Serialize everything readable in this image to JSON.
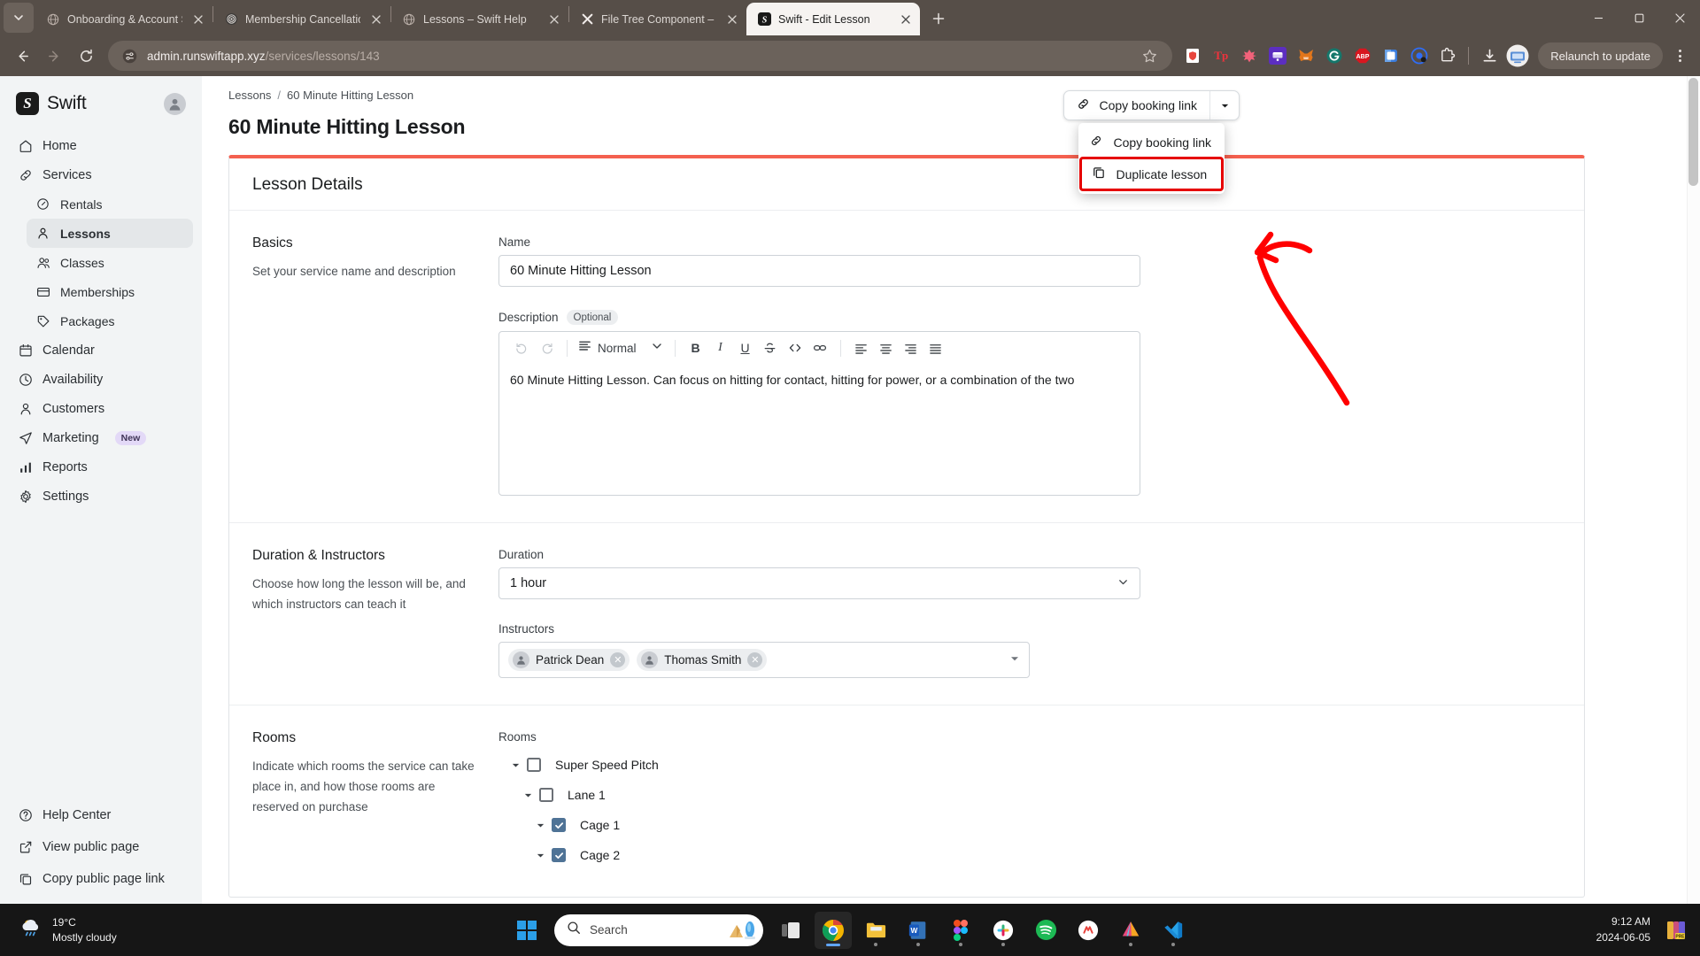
{
  "browser": {
    "tabs": [
      {
        "title": "Onboarding & Account Setup -",
        "favicon": "globe-icon",
        "active": false
      },
      {
        "title": "Membership Cancellation Instru",
        "favicon": "fingerprint-icon",
        "active": false
      },
      {
        "title": "Lessons – Swift Help",
        "favicon": "globe-icon",
        "active": false
      },
      {
        "title": "File Tree Component – Nextra",
        "favicon": "nextra-icon",
        "active": false
      },
      {
        "title": "Swift - Edit Lesson",
        "favicon": "swift-icon",
        "active": true
      }
    ],
    "new_tab_label": "+",
    "url_host": "admin.runswiftapp.xyz",
    "url_path": "/services/lessons/143",
    "relaunch_label": "Relaunch to update",
    "extensions": [
      {
        "name": "shield-extension-icon",
        "glyph": "",
        "color": "#e8453c"
      },
      {
        "name": "tp-extension-icon",
        "glyph": "Tp",
        "color": "#f0323c"
      },
      {
        "name": "puzzle-pink-extension-icon",
        "glyph": "",
        "color": "#f2627a"
      },
      {
        "name": "rabby-wallet-icon",
        "glyph": "",
        "color": "#5c2ec0"
      },
      {
        "name": "metamask-icon",
        "glyph": "",
        "color": "#e2761b"
      },
      {
        "name": "grammarly-icon",
        "glyph": "G",
        "color": "#15776b"
      },
      {
        "name": "adblock-plus-icon",
        "glyph": "ABP",
        "color": "#d8161f"
      },
      {
        "name": "bitwarden-icon",
        "glyph": "",
        "color": "#3b7ddd"
      },
      {
        "name": "loom-icon",
        "glyph": "",
        "color": "#2f6df6"
      },
      {
        "name": "extensions-puzzle-icon",
        "glyph": "",
        "color": "#ffffff"
      }
    ],
    "download_icon": "download-icon",
    "profile_icon": "profile-avatar-icon",
    "window_controls": [
      "minimize",
      "maximize",
      "close"
    ]
  },
  "sidebar": {
    "brand": {
      "logo_letter": "S",
      "name": "Swift"
    },
    "items": [
      {
        "label": "Home",
        "icon": "home-icon",
        "level": 0,
        "active": false
      },
      {
        "label": "Services",
        "icon": "link-icon",
        "level": 0,
        "active": false
      },
      {
        "label": "Rentals",
        "icon": "gauge-icon",
        "level": 1,
        "active": false
      },
      {
        "label": "Lessons",
        "icon": "person-icon",
        "level": 1,
        "active": true
      },
      {
        "label": "Classes",
        "icon": "people-icon",
        "level": 1,
        "active": false
      },
      {
        "label": "Memberships",
        "icon": "card-icon",
        "level": 1,
        "active": false
      },
      {
        "label": "Packages",
        "icon": "tags-icon",
        "level": 1,
        "active": false
      },
      {
        "label": "Calendar",
        "icon": "calendar-icon",
        "level": 0,
        "active": false
      },
      {
        "label": "Availability",
        "icon": "clock-icon",
        "level": 0,
        "active": false
      },
      {
        "label": "Customers",
        "icon": "person-icon",
        "level": 0,
        "active": false
      },
      {
        "label": "Marketing",
        "icon": "send-icon",
        "level": 0,
        "active": false,
        "badge": "New"
      },
      {
        "label": "Reports",
        "icon": "bar-chart-icon",
        "level": 0,
        "active": false
      },
      {
        "label": "Settings",
        "icon": "gear-icon",
        "level": 0,
        "active": false
      }
    ],
    "bottom_items": [
      {
        "label": "Help Center",
        "icon": "question-circle-icon"
      },
      {
        "label": "View public page",
        "icon": "external-link-icon"
      },
      {
        "label": "Copy public page link",
        "icon": "copy-icon"
      }
    ]
  },
  "main": {
    "breadcrumb": {
      "parent": "Lessons",
      "separator": "/",
      "current": "60 Minute Hitting Lesson"
    },
    "page_title": "60 Minute Hitting Lesson",
    "copy_button": {
      "label": "Copy booking link",
      "icon": "link-icon",
      "caret": "chevron-down-icon"
    },
    "dropdown": {
      "open": true,
      "items": [
        {
          "label": "Copy booking link",
          "icon": "link-icon",
          "highlighted": false
        },
        {
          "label": "Duplicate lesson",
          "icon": "copy-icon",
          "highlighted": true
        }
      ]
    },
    "annotation": {
      "type": "arrow",
      "color": "#ff0000",
      "points_to": "Duplicate lesson"
    },
    "card_title": "Lesson Details",
    "sections": [
      {
        "title": "Basics",
        "description": "Set your service name and description",
        "name_label": "Name",
        "name_value": "60 Minute Hitting Lesson",
        "description_label": "Description",
        "description_chip": "Optional",
        "description_value": "60 Minute Hitting Lesson. Can focus on hitting for contact, hitting for power, or a combination of the two",
        "editor_style": "Normal",
        "editor_tools": [
          "undo-icon",
          "redo-icon",
          "paragraph-style-dropdown",
          "bold-icon",
          "italic-icon",
          "underline-icon",
          "strikethrough-icon",
          "code-icon",
          "link-icon",
          "align-left-icon",
          "align-center-icon",
          "align-right-icon",
          "align-justify-icon"
        ]
      },
      {
        "title": "Duration & Instructors",
        "description": "Choose how long the lesson will be, and which instructors can teach it",
        "duration_label": "Duration",
        "duration_value": "1 hour",
        "instructors_label": "Instructors",
        "instructors": [
          "Patrick Dean",
          "Thomas Smith"
        ]
      },
      {
        "title": "Rooms",
        "description": "Indicate which rooms the service can take place in, and how those rooms are reserved on purchase",
        "rooms_label": "Rooms",
        "tree": [
          {
            "label": "Super Speed Pitch",
            "depth": 0,
            "checked": false
          },
          {
            "label": "Lane 1",
            "depth": 1,
            "checked": false
          },
          {
            "label": "Cage 1",
            "depth": 2,
            "checked": true
          },
          {
            "label": "Cage 2",
            "depth": 2,
            "checked": true
          }
        ]
      }
    ],
    "accent_color": "#f4604f",
    "checkbox_color": "#4f7396"
  },
  "taskbar": {
    "weather": {
      "temperature": "19°C",
      "condition": "Mostly cloudy",
      "icon": "cloud-rain-icon"
    },
    "start_icon": "windows-start-icon",
    "search_placeholder": "Search",
    "search_icon": "search-icon",
    "apps": [
      {
        "name": "task-view-icon",
        "running": false
      },
      {
        "name": "chrome-icon",
        "running": true
      },
      {
        "name": "file-explorer-icon",
        "running": true
      },
      {
        "name": "word-icon",
        "running": true
      },
      {
        "name": "figma-icon",
        "running": true
      },
      {
        "name": "slack-icon",
        "running": true
      },
      {
        "name": "spotify-icon",
        "running": false
      },
      {
        "name": "zoho-icon",
        "running": false
      },
      {
        "name": "affinity-icon",
        "running": true
      },
      {
        "name": "vscode-icon",
        "running": true
      }
    ],
    "clock": {
      "time": "9:12 AM",
      "date": "2024-06-05"
    },
    "tray_icon": "tray-app-icon"
  }
}
